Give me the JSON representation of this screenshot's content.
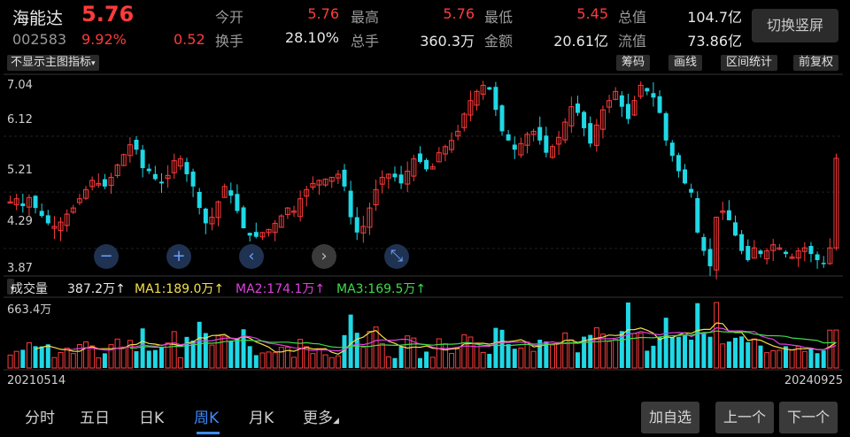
{
  "header": {
    "name": "海能达",
    "price": "5.76",
    "code": "002583",
    "change_pct": "9.92%",
    "change": "0.52",
    "stats": [
      {
        "label": "今开",
        "value": "5.76",
        "color": "red"
      },
      {
        "label": "最高",
        "value": "5.76",
        "color": "red"
      },
      {
        "label": "最低",
        "value": "5.45",
        "color": "red"
      },
      {
        "label": "总值",
        "value": "104.7亿",
        "color": "white"
      },
      {
        "label": "换手",
        "value": "28.10%",
        "color": "white"
      },
      {
        "label": "总手",
        "value": "360.3万",
        "color": "white"
      },
      {
        "label": "金额",
        "value": "20.61亿",
        "color": "white"
      },
      {
        "label": "流值",
        "value": "73.86亿",
        "color": "white"
      }
    ],
    "switch_label": "切换竖屏"
  },
  "toolbar": {
    "indicator_label": "不显示主图指标",
    "indicator_arrow": "▾",
    "buttons": [
      "筹码",
      "画线",
      "区间统计",
      "前复权"
    ]
  },
  "price_axis": {
    "labels": [
      "7.04",
      "6.12",
      "5.21",
      "4.29",
      "3.87"
    ],
    "values": [
      7.04,
      6.12,
      5.21,
      4.29,
      3.87
    ]
  },
  "volume_panel": {
    "indicator_label": "成交量",
    "indicator_arrow": "▾",
    "volume": "387.2万↑",
    "ma1": "MA1:189.0万↑",
    "ma2": "MA2:174.1万↑",
    "ma3": "MA3:169.5万↑",
    "max_label": "663.4万",
    "start_date": "20210514",
    "end_date": "20240925"
  },
  "colors": {
    "up": "#ff3b3b",
    "down": "#1fd8e6",
    "ma1": "#f2e04a",
    "ma2": "#e040e0",
    "ma3": "#3ddc4a",
    "accent": "#3d8cff"
  },
  "chart_controls": [
    "zoom-out",
    "zoom-in",
    "scroll-left",
    "scroll-right",
    "reset"
  ],
  "chart_glyphs": {
    "zoom-out": "−",
    "zoom-in": "+",
    "scroll-left": "‹",
    "scroll-right": "›",
    "reset": "⤡"
  },
  "bottom_tabs": [
    "分时",
    "五日",
    "日K",
    "周K",
    "月K",
    "更多"
  ],
  "bottom_tabs_more_glyph": "◢",
  "active_tab": "周K",
  "bottom_buttons": [
    "加自选",
    "上一个",
    "下一个"
  ],
  "chart_data": {
    "type": "candlestick",
    "period": "weekly",
    "y_range": [
      3.87,
      7.1
    ],
    "close_series": [
      5.05,
      5.1,
      4.98,
      5.12,
      4.95,
      4.82,
      4.7,
      4.65,
      4.72,
      4.85,
      4.95,
      5.1,
      5.25,
      5.4,
      5.35,
      5.3,
      5.45,
      5.65,
      5.82,
      5.98,
      5.9,
      5.6,
      5.55,
      5.42,
      5.35,
      5.48,
      5.72,
      5.75,
      5.5,
      5.3,
      4.95,
      4.7,
      4.8,
      5.05,
      5.3,
      5.15,
      4.9,
      4.62,
      4.5,
      4.48,
      4.55,
      4.6,
      4.7,
      4.82,
      4.95,
      4.9,
      5.1,
      5.25,
      5.35,
      5.4,
      5.42,
      5.45,
      5.5,
      5.3,
      4.8,
      4.55,
      4.65,
      4.95,
      5.25,
      5.45,
      5.5,
      5.45,
      5.35,
      5.55,
      5.75,
      5.7,
      5.58,
      5.62,
      5.85,
      5.95,
      6.05,
      6.2,
      6.48,
      6.7,
      6.85,
      6.95,
      6.88,
      6.55,
      6.2,
      6.05,
      5.9,
      6.0,
      6.15,
      6.2,
      6.05,
      5.85,
      5.95,
      6.1,
      6.35,
      6.6,
      6.5,
      6.25,
      6.0,
      6.3,
      6.55,
      6.7,
      6.85,
      6.6,
      6.4,
      6.7,
      6.95,
      6.85,
      6.75,
      6.5,
      6.05,
      5.8,
      5.55,
      5.35,
      5.2,
      4.55,
      4.25,
      4.0,
      4.8,
      4.9,
      4.75,
      4.5,
      4.25,
      4.1,
      4.3,
      4.2,
      4.25,
      4.35,
      4.3,
      4.2,
      4.15,
      4.25,
      4.3,
      4.2,
      4.1,
      4.05,
      4.3,
      5.76
    ],
    "volume_max_label": "663.4万"
  }
}
